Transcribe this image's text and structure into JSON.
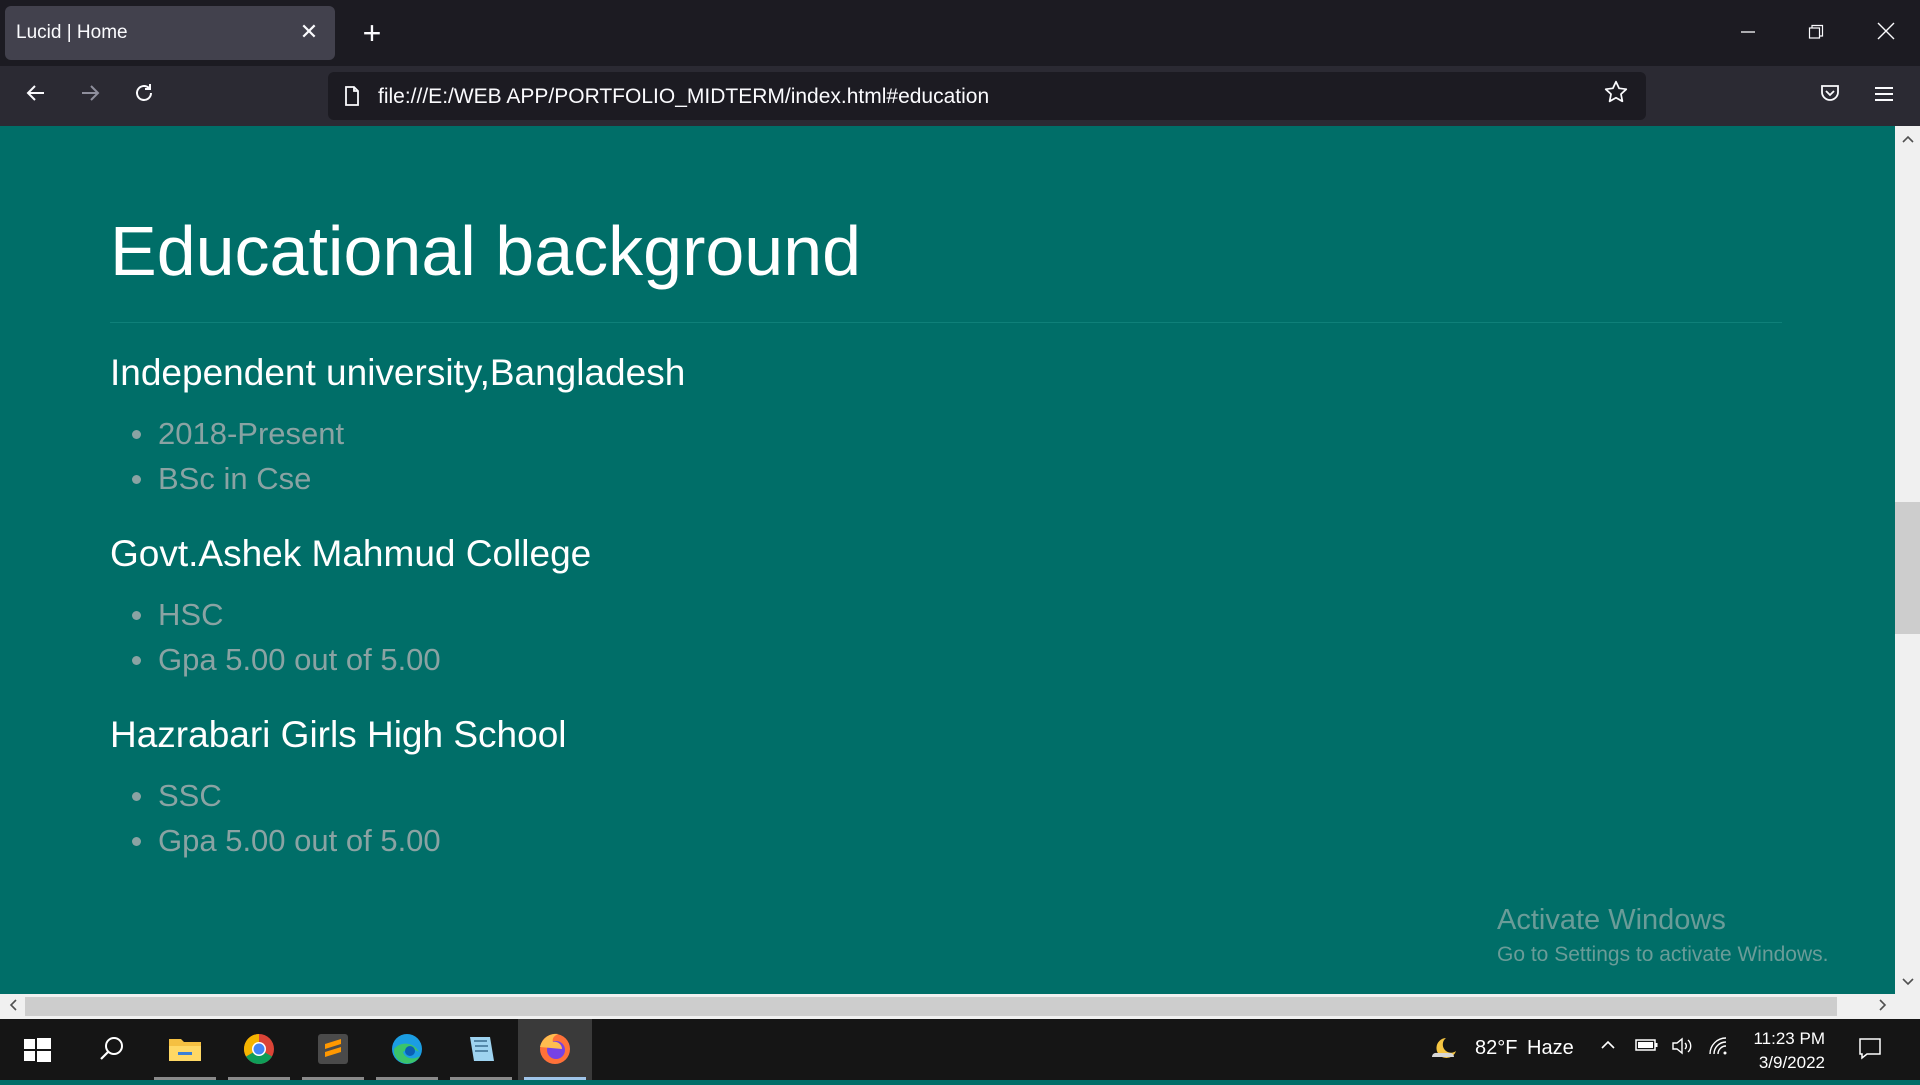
{
  "browser": {
    "tab_title": "Lucid | Home",
    "url": "file:///E:/WEB APP/PORTFOLIO_MIDTERM/index.html#education"
  },
  "page": {
    "heading": "Educational background",
    "schools": [
      {
        "name": "Independent university,Bangladesh",
        "items": [
          "2018-Present",
          "BSc in Cse"
        ]
      },
      {
        "name": "Govt.Ashek Mahmud College",
        "items": [
          "HSC",
          "Gpa 5.00 out of 5.00"
        ]
      },
      {
        "name": "Hazrabari Girls High School",
        "items": [
          "SSC",
          "Gpa 5.00 out of 5.00"
        ]
      }
    ],
    "watermark": {
      "line1": "Activate Windows",
      "line2": "Go to Settings to activate Windows."
    }
  },
  "taskbar": {
    "weather_temp": "82°F",
    "weather_desc": "Haze",
    "time": "11:23 PM",
    "date": "3/9/2022",
    "apps": [
      "start-icon",
      "search-icon",
      "file-explorer-icon",
      "chrome-icon",
      "sublime-text-icon",
      "edge-icon",
      "notepad-icon",
      "firefox-icon"
    ]
  },
  "colors": {
    "page_background": "#006e68",
    "heading": "#ffffff",
    "list_text": "#8aa3a3"
  }
}
